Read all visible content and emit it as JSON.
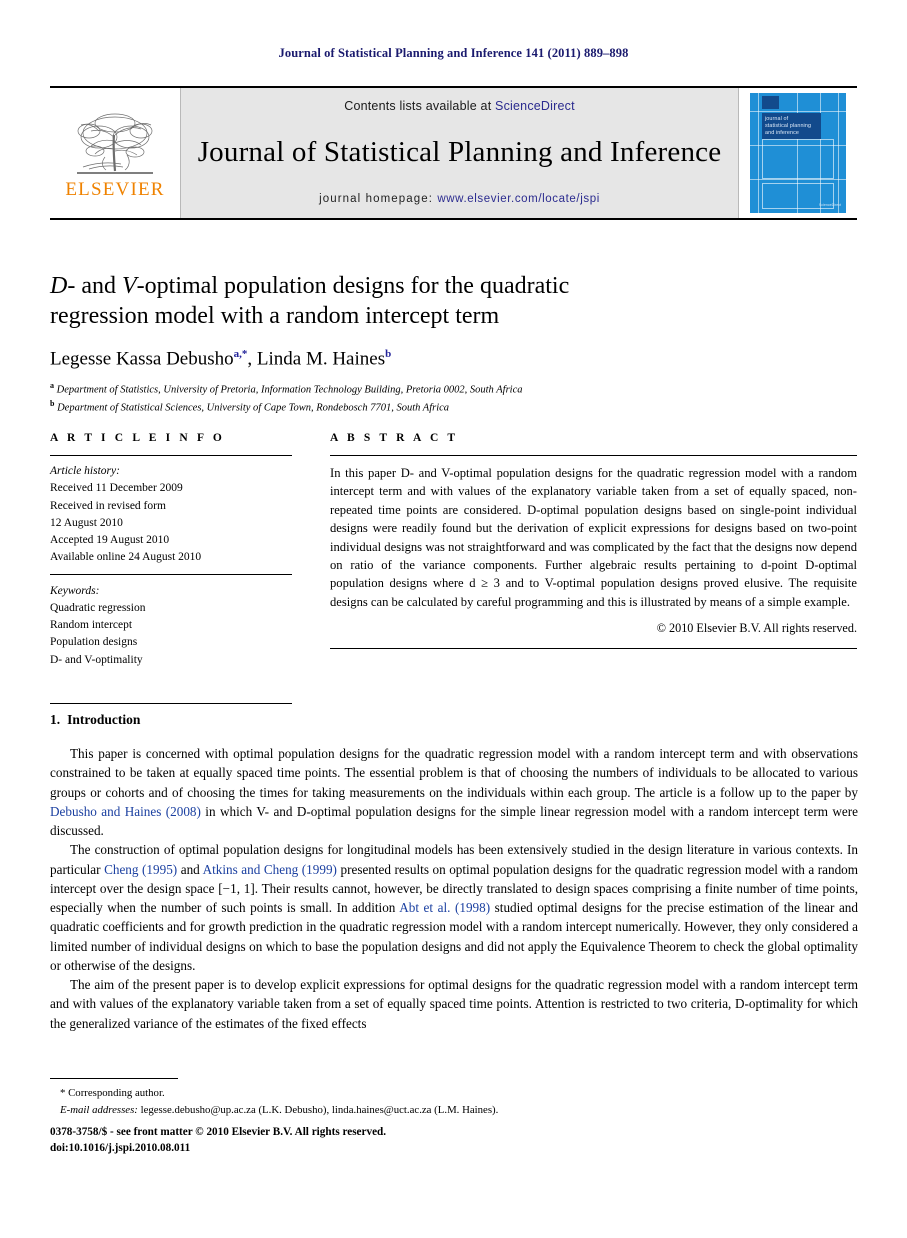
{
  "running_head": "Journal of Statistical Planning and Inference 141 (2011) 889–898",
  "masthead": {
    "publisher_logo_text": "ELSEVIER",
    "publisher_logo_icon": "elsevier-tree-icon",
    "contents_prefix": "Contents lists available at ",
    "contents_link": "ScienceDirect",
    "journal_title": "Journal of Statistical Planning and Inference",
    "homepage_prefix": "journal homepage: ",
    "homepage_link": "www.elsevier.com/locate/jspi",
    "cover": {
      "title_line1": "journal of",
      "title_line2": "statistical planning",
      "title_line3": "and inference",
      "mark": "ScienceDirect",
      "background_color": "#1f8fd6",
      "panel_color": "#124a8c"
    },
    "link_color": "#2b2b8f",
    "panel_color": "#e6e6e6",
    "logo_color": "#ef8200"
  },
  "article": {
    "title_line1_a": "D",
    "title_line1_b": "- and ",
    "title_line1_c": "V",
    "title_line1_d": "-optimal population designs for the quadratic",
    "title_line2": "regression model with a random intercept term",
    "authors": [
      {
        "name": "Legesse Kassa Debusho",
        "marks": "a,*"
      },
      {
        "name": "Linda M. Haines",
        "marks": "b"
      }
    ],
    "authors_separator": ", ",
    "affiliations": [
      {
        "mark": "a",
        "text": "Department of Statistics, University of Pretoria, Information Technology Building, Pretoria 0002, South Africa"
      },
      {
        "mark": "b",
        "text": "Department of Statistical Sciences, University of Cape Town, Rondebosch 7701, South Africa"
      }
    ]
  },
  "article_info": {
    "heading": "A R T I C L E   I N F O",
    "history_label": "Article history:",
    "history": [
      "Received 11 December 2009",
      "Received in revised form",
      "12 August 2010",
      "Accepted 19 August 2010",
      "Available online 24 August 2010"
    ],
    "keywords_label": "Keywords:",
    "keywords": [
      "Quadratic regression",
      "Random intercept",
      "Population designs",
      "D- and V-optimality"
    ]
  },
  "abstract": {
    "heading": "A B S T R A C T",
    "text": "In this paper D- and V-optimal population designs for the quadratic regression model with a random intercept term and with values of the explanatory variable taken from a set of equally spaced, non-repeated time points are considered. D-optimal population designs based on single-point individual designs were readily found but the derivation of explicit expressions for designs based on two-point individual designs was not straightforward and was complicated by the fact that the designs now depend on ratio of the variance components. Further algebraic results pertaining to d-point D-optimal population designs where d ≥ 3 and to V-optimal population designs proved elusive. The requisite designs can be calculated by careful programming and this is illustrated by means of a simple example.",
    "copyright": "© 2010 Elsevier B.V. All rights reserved."
  },
  "introduction": {
    "number": "1.",
    "heading": "Introduction",
    "paragraph1_pre": "This paper is concerned with optimal population designs for the quadratic regression model with a random intercept term and with observations constrained to be taken at equally spaced time points. The essential problem is that of choosing the numbers of individuals to be allocated to various groups or cohorts and of choosing the times for taking measurements on the individuals within each group. The article is a follow up to the paper by ",
    "paragraph1_cite": "Debusho and Haines (2008)",
    "paragraph1_post": " in which V- and D-optimal population designs for the simple linear regression model with a random intercept term were discussed.",
    "paragraph2_pre": "The construction of optimal population designs for longitudinal models has been extensively studied in the design literature in various contexts. In particular ",
    "paragraph2_cite1": "Cheng (1995)",
    "paragraph2_mid1": " and ",
    "paragraph2_cite2": "Atkins and Cheng (1999)",
    "paragraph2_mid2": " presented results on optimal population designs for the quadratic regression model with a random intercept over the design space [−1, 1]. Their results cannot, however, be directly translated to design spaces comprising a finite number of time points, especially when the number of such points is small. In addition ",
    "paragraph2_cite3": "Abt et al. (1998)",
    "paragraph2_post": " studied optimal designs for the precise estimation of the linear and quadratic coefficients and for growth prediction in the quadratic regression model with a random intercept numerically. However, they only considered a limited number of individual designs on which to base the population designs and did not apply the Equivalence Theorem to check the global optimality or otherwise of the designs.",
    "paragraph3": "The aim of the present paper is to develop explicit expressions for optimal designs for the quadratic regression model with a random intercept term and with values of the explanatory variable taken from a set of equally spaced time points. Attention is restricted to two criteria, D-optimality for which the generalized variance of the estimates of the fixed effects",
    "cite_color": "#1a3fa0"
  },
  "footnote": {
    "corresponding": "* Corresponding author.",
    "email_label": "E-mail addresses:",
    "email_text": " legesse.debusho@up.ac.za (L.K. Debusho), linda.haines@uct.ac.za (L.M. Haines)."
  },
  "footer": {
    "line1": "0378-3758/$ - see front matter © 2010 Elsevier B.V. All rights reserved.",
    "line2": "doi:10.1016/j.jspi.2010.08.011"
  }
}
